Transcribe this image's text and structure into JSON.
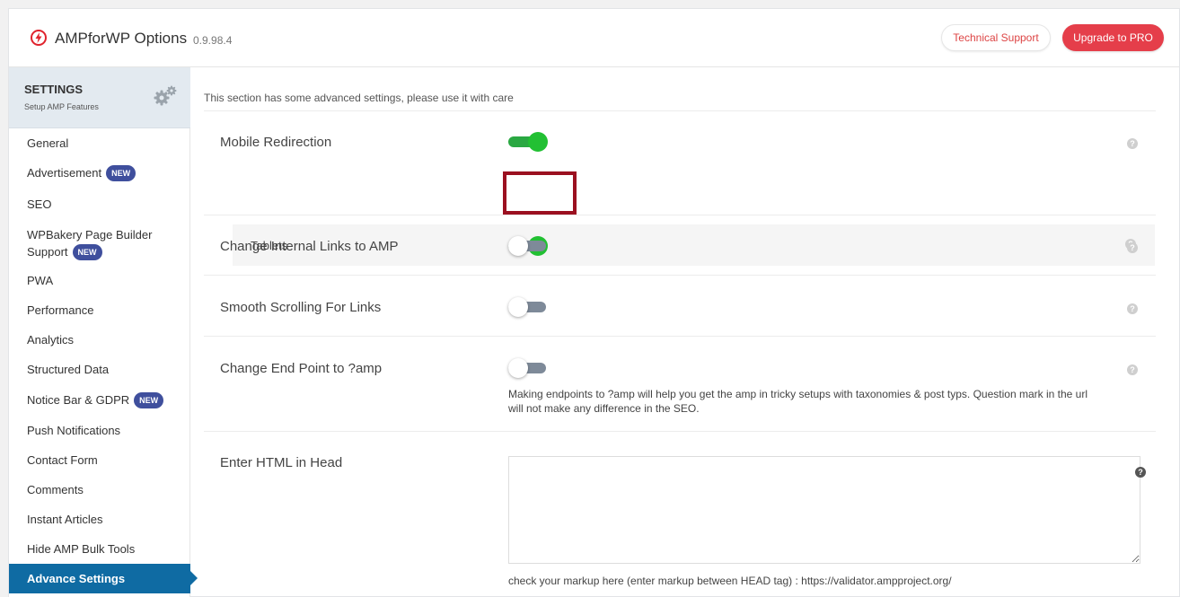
{
  "header": {
    "title": "AMPforWP Options",
    "version": "0.9.98.4",
    "support_label": "Technical Support",
    "pro_label": "Upgrade to PRO"
  },
  "sidebar": {
    "title": "SETTINGS",
    "subtitle": "Setup AMP Features",
    "items": [
      {
        "label": "General"
      },
      {
        "label": "Advertisement",
        "badge": "NEW"
      },
      {
        "label": "SEO"
      },
      {
        "label": "WPBakery Page Builder Support",
        "badge": "NEW"
      },
      {
        "label": "PWA"
      },
      {
        "label": "Performance"
      },
      {
        "label": "Analytics"
      },
      {
        "label": "Structured Data"
      },
      {
        "label": "Notice Bar & GDPR",
        "badge": "NEW"
      },
      {
        "label": "Push Notifications"
      },
      {
        "label": "Contact Form"
      },
      {
        "label": "Comments"
      },
      {
        "label": "Instant Articles"
      },
      {
        "label": "Hide AMP Bulk Tools"
      },
      {
        "label": "Advance Settings",
        "active": true
      }
    ]
  },
  "main": {
    "description": "This section has some advanced settings, please use it with care",
    "settings": {
      "mobile_redirection": {
        "label": "Mobile Redirection",
        "enabled": true
      },
      "tablets": {
        "label": "Tablets",
        "enabled": true
      },
      "internal_links": {
        "label": "Change Internal Links to AMP",
        "enabled": false
      },
      "smooth_scroll": {
        "label": "Smooth Scrolling For Links",
        "enabled": false
      },
      "end_point": {
        "label": "Change End Point to ?amp",
        "enabled": false,
        "note_line1": "Making endpoints to ?amp will help you get the amp in tricky setups with taxonomies & post typs. Question mark in the url",
        "note_line2": "will not make any difference in the SEO."
      },
      "html_head": {
        "label": "Enter HTML in Head",
        "value": "",
        "note": "check your markup here (enter markup between HEAD tag) : https://validator.ampproject.org/"
      }
    },
    "help_glyph": "?"
  },
  "colors": {
    "accent": "#0f6ba3",
    "pro_button": "#e53e4a",
    "toggle_on": "#22c033",
    "badge": "#3f4f9d",
    "highlight": "#9b1020"
  }
}
